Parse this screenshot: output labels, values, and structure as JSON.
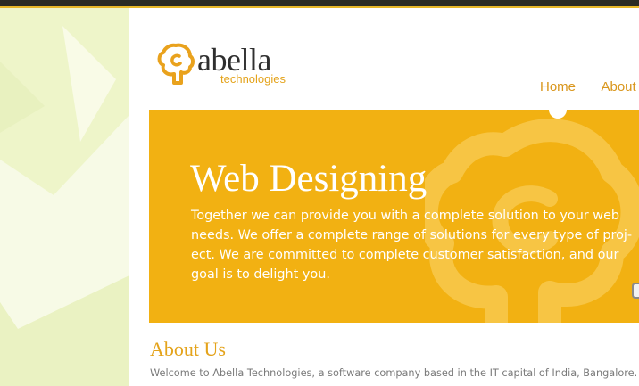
{
  "brand": {
    "name": "abella",
    "tagline": "technologies",
    "accent_color": "#f2b112",
    "logo_icon": "brain-gear-icon"
  },
  "nav": {
    "items": [
      {
        "label": "Home"
      },
      {
        "label": "About"
      }
    ]
  },
  "banner": {
    "title": "Web Designing",
    "text": "Together we can provide you with a complete solution to your web needs. We offer a complete range of solutions for every type of proj-ect. We are committed to complete customer satisfaction, and our goal is to delight you."
  },
  "about": {
    "title": "About Us",
    "text": "Welcome to Abella Technologies, a software company based in the IT capital of India, Bangalore."
  }
}
